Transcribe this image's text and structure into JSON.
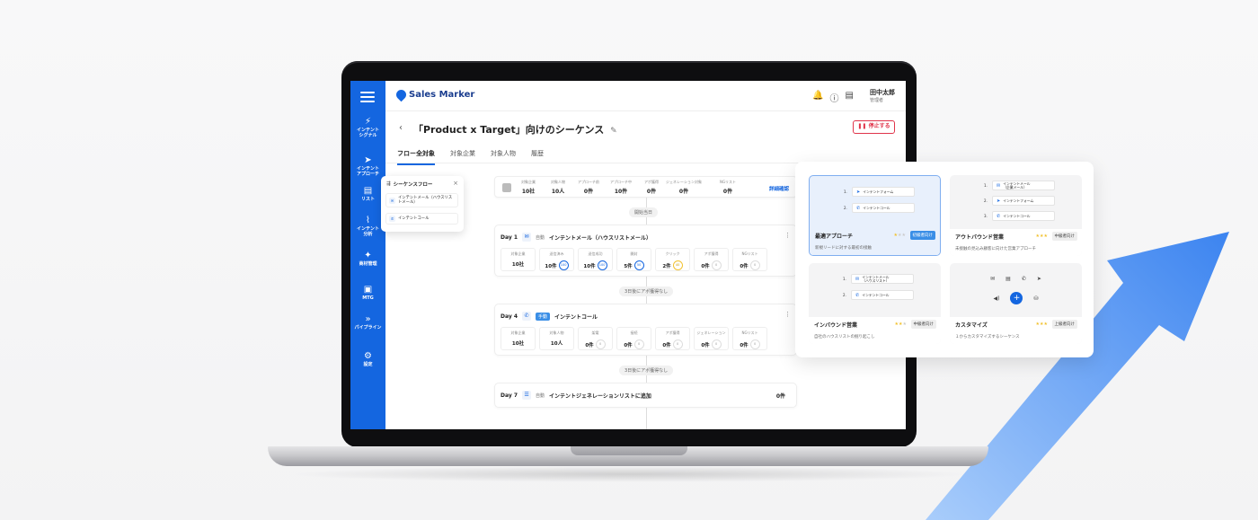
{
  "brand": {
    "name": "Sales Marker",
    "accent": "#1466e0",
    "danger": "#e0344a"
  },
  "sidebar": {
    "items": [
      {
        "icon": "intent-signal-icon",
        "label": "インテント\nシグナル"
      },
      {
        "icon": "send-icon",
        "label": "インテント\nアプローチ"
      },
      {
        "icon": "list-icon",
        "label": "リスト"
      },
      {
        "icon": "analysis-icon",
        "label": "インテント\n分析"
      },
      {
        "icon": "sparkle-icon",
        "label": "商材管理"
      },
      {
        "icon": "video-icon",
        "label": "MTG"
      },
      {
        "icon": "pipeline-icon",
        "label": "パイプライン"
      },
      {
        "icon": "gear-icon",
        "label": "設定"
      }
    ]
  },
  "header": {
    "user_name": "田中太郎",
    "user_role": "管理者"
  },
  "page": {
    "title": "「Product x Target」向けのシーケンス",
    "stop_label": "停止する",
    "tabs": [
      "フロー全対象",
      "対象企業",
      "対象人物",
      "履歴"
    ]
  },
  "summary": {
    "stats": [
      {
        "label": "対象企業",
        "value": "10社"
      },
      {
        "label": "対象人物",
        "value": "10人"
      },
      {
        "label": "アプローチ前",
        "value": "0件"
      },
      {
        "label": "アプローチ中",
        "value": "10件"
      },
      {
        "label": "アポ獲得",
        "value": "0件"
      },
      {
        "label": "ジェネレーション対象",
        "value": "0件"
      },
      {
        "label": "NGリスト",
        "value": "0件"
      }
    ],
    "detail_link": "詳細確認"
  },
  "flow": {
    "start_label": "開始当日",
    "gap1": "3日後にアポ獲得なし",
    "gap2": "3日後にアポ獲得なし",
    "days": [
      {
        "day": "Day 1",
        "mode": "自動",
        "name": "インテントメール（ハウスリストメール）",
        "metrics": [
          {
            "label": "対象企業",
            "value": "10社",
            "ring": ""
          },
          {
            "label": "送信済み",
            "value": "10件",
            "ring": "100"
          },
          {
            "label": "送信成功",
            "value": "10件",
            "ring": "100"
          },
          {
            "label": "開封",
            "value": "5件",
            "ring": "50"
          },
          {
            "label": "クリック",
            "value": "2件",
            "ring": "40"
          },
          {
            "label": "アポ獲得",
            "value": "0件",
            "ring": "0"
          },
          {
            "label": "NGリスト",
            "value": "0件",
            "ring": "0"
          }
        ]
      },
      {
        "day": "Day 4",
        "mode": "手動",
        "name": "インテントコール",
        "metrics": [
          {
            "label": "対象企業",
            "value": "10社",
            "ring": ""
          },
          {
            "label": "対象人物",
            "value": "10人",
            "ring": ""
          },
          {
            "label": "架電",
            "value": "0件",
            "ring": "0"
          },
          {
            "label": "接続",
            "value": "0件",
            "ring": "0"
          },
          {
            "label": "アポ獲得",
            "value": "0件",
            "ring": "0"
          },
          {
            "label": "ジェネレーション",
            "value": "0件",
            "ring": "0"
          },
          {
            "label": "NGリスト",
            "value": "0件",
            "ring": "0"
          }
        ]
      },
      {
        "day": "Day 7",
        "mode": "自動",
        "name": "インテントジェネレーションリストに追加",
        "count": "0件"
      }
    ]
  },
  "sequence_flow_panel": {
    "title": "シーケンスフロー",
    "items": [
      "インテントメール（ハウスリストメール）",
      "インテントコール"
    ]
  },
  "templates": [
    {
      "name": "最適アプローチ",
      "stars": 1,
      "badge": "初級者向け",
      "desc": "新規リードに対する最初の接触",
      "steps": [
        "インテントフォーム",
        "インテントコール"
      ]
    },
    {
      "name": "アウトバウンド営業",
      "stars": 3,
      "badge": "中級者向け",
      "desc": "未接触の見込み顧客に向けた営業アプローチ",
      "steps": [
        "インテントメール\n（企業メール）",
        "インテントフォーム",
        "インテントコール"
      ]
    },
    {
      "name": "インバウンド営業",
      "stars": 2,
      "badge": "中級者向け",
      "desc": "自社のハウスリストの掘り起こし",
      "steps": [
        "インテントメール\n（ハウスリスト）",
        "インテントコール"
      ]
    },
    {
      "name": "カスタマイズ",
      "stars": 3,
      "badge": "上級者向け",
      "desc": "１からカスタマイズするシーケンス",
      "steps": []
    }
  ]
}
